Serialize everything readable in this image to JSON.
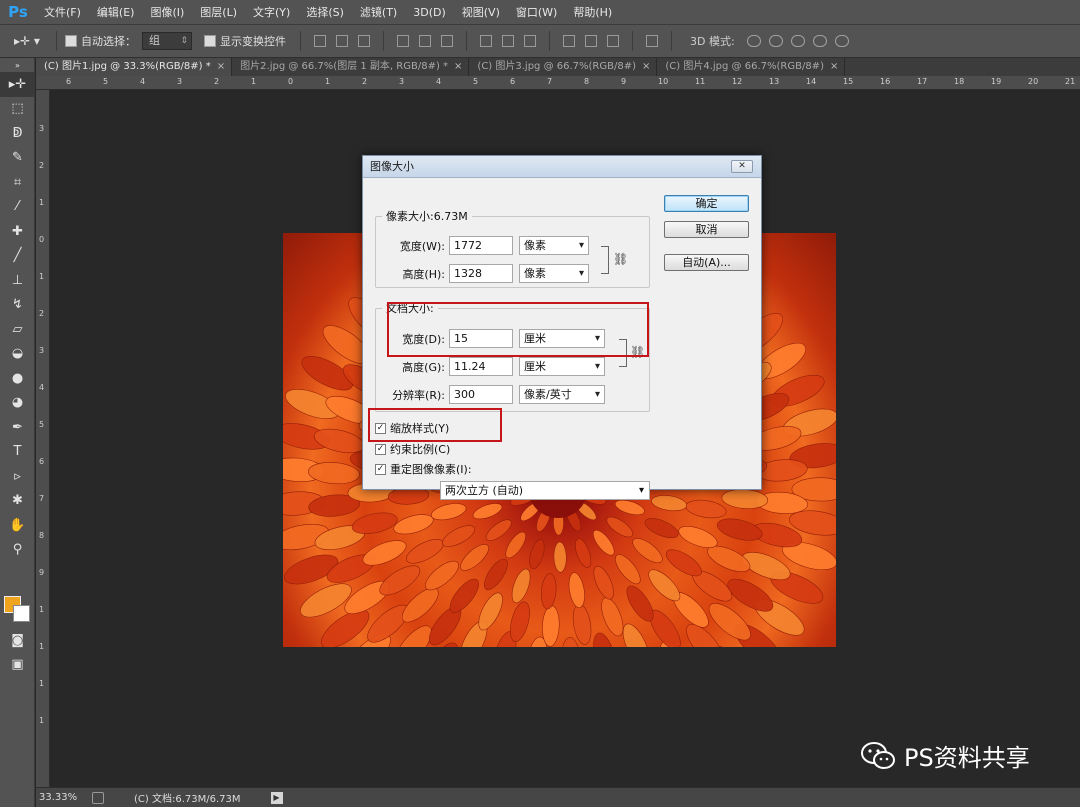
{
  "app": {
    "logo": "Ps",
    "menu": [
      "文件(F)",
      "编辑(E)",
      "图像(I)",
      "图层(L)",
      "文字(Y)",
      "选择(S)",
      "滤镜(T)",
      "3D(D)",
      "视图(V)",
      "窗口(W)",
      "帮助(H)"
    ]
  },
  "options_bar": {
    "auto_select_label": "自动选择：",
    "auto_select_value": "组",
    "show_transform_label": "显示变换控件",
    "mode_3d_label": "3D 模式:"
  },
  "tabs": [
    {
      "label": "(C) 图片1.jpg @ 33.3%(RGB/8#) *",
      "close": "×"
    },
    {
      "label": "图片2.jpg @ 66.7%(图层 1 副本, RGB/8#) *",
      "close": "×"
    },
    {
      "label": "(C) 图片3.jpg @ 66.7%(RGB/8#)",
      "close": "×"
    },
    {
      "label": "(C) 图片4.jpg @ 66.7%(RGB/8#)",
      "close": "×"
    }
  ],
  "rulers": {
    "top": [
      "6",
      "5",
      "4",
      "3",
      "2",
      "1",
      "0",
      "1",
      "2",
      "3",
      "4",
      "5",
      "6",
      "7",
      "8",
      "9",
      "10",
      "11",
      "12",
      "13",
      "14",
      "15",
      "16",
      "17",
      "18",
      "19",
      "20",
      "21"
    ],
    "left": [
      "3",
      "2",
      "1",
      "0",
      "1",
      "2",
      "3",
      "4",
      "5",
      "6",
      "7",
      "8",
      "9",
      "1",
      "1",
      "1",
      "1"
    ]
  },
  "colors": {
    "foreground": "#f0a31c",
    "background": "#ffffff",
    "highlight": "#c6141b"
  },
  "dialog": {
    "title": "图像大小",
    "close": "✕",
    "pixel_dimensions": {
      "legend": "像素大小:6.73M",
      "width_label": "宽度(W):",
      "width_value": "1772",
      "width_unit": "像素",
      "height_label": "高度(H):",
      "height_value": "1328",
      "height_unit": "像素"
    },
    "document_size": {
      "legend": "文档大小:",
      "width_label": "宽度(D):",
      "width_value": "15",
      "width_unit": "厘米",
      "height_label": "高度(G):",
      "height_value": "11.24",
      "height_unit": "厘米",
      "resolution_label": "分辨率(R):",
      "resolution_value": "300",
      "resolution_unit": "像素/英寸"
    },
    "buttons": {
      "ok": "确定",
      "cancel": "取消",
      "auto": "自动(A)..."
    },
    "checkboxes": {
      "scale_styles": "缩放样式(Y)",
      "constrain_proportions": "约束比例(C)",
      "resample": "重定图像像素(I):"
    },
    "resample_method": "两次立方 (自动)"
  },
  "status": {
    "zoom": "33.33%",
    "doc_info": "(C) 文档:6.73M/6.73M"
  },
  "watermark": "PS资料共享"
}
